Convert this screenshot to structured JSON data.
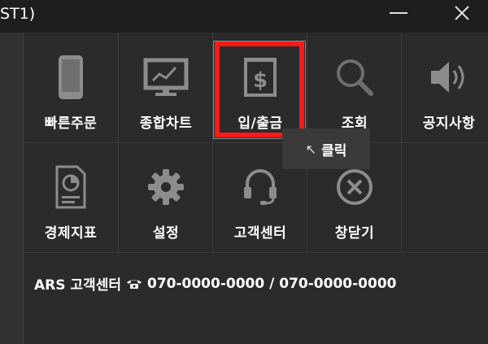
{
  "window": {
    "title": "ST1)"
  },
  "menu": {
    "row1": [
      {
        "label": "빠른주문",
        "icon": "smartphone-icon"
      },
      {
        "label": "종합차트",
        "icon": "monitor-chart-icon"
      },
      {
        "label": "입/출금",
        "icon": "dollar-receipt-icon"
      },
      {
        "label": "조회",
        "icon": "magnifier-icon"
      },
      {
        "label": "공지사항",
        "icon": "speaker-icon"
      }
    ],
    "row2": [
      {
        "label": "경제지표",
        "icon": "report-chart-icon"
      },
      {
        "label": "설정",
        "icon": "gear-icon"
      },
      {
        "label": "고객센터",
        "icon": "headset-icon"
      },
      {
        "label": "창닫기",
        "icon": "close-circle-icon"
      }
    ]
  },
  "tooltip": {
    "text": "클릭",
    "cursor": "↖"
  },
  "footer": {
    "prefix": "ARS 고객센터",
    "numbers": "070-0000-0000 / 070-0000-0000"
  },
  "colors": {
    "highlight": "#ff1a1a",
    "icon": "#8c8c8c",
    "background": "#2b2b2b"
  }
}
